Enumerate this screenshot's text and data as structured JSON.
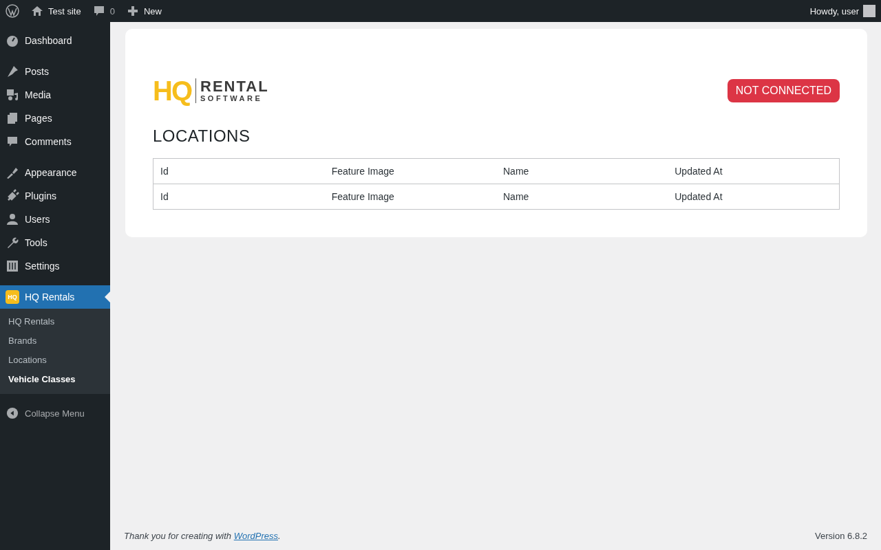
{
  "admin_bar": {
    "site_name": "Test site",
    "comments_count": "0",
    "new_label": "New",
    "greeting": "Howdy, user"
  },
  "sidebar": {
    "groups": [
      [
        {
          "label": "Dashboard",
          "kind": "dashboard",
          "selected": false
        }
      ],
      [
        {
          "label": "Posts",
          "kind": "pin",
          "selected": false
        },
        {
          "label": "Media",
          "kind": "media",
          "selected": false
        },
        {
          "label": "Pages",
          "kind": "pages",
          "selected": false
        },
        {
          "label": "Comments",
          "kind": "comment",
          "selected": false
        }
      ],
      [
        {
          "label": "Appearance",
          "kind": "brush",
          "selected": false
        },
        {
          "label": "Plugins",
          "kind": "plug",
          "selected": false
        },
        {
          "label": "Users",
          "kind": "user",
          "selected": false
        },
        {
          "label": "Tools",
          "kind": "wrench",
          "selected": false
        },
        {
          "label": "Settings",
          "kind": "sliders",
          "selected": false
        }
      ],
      [
        {
          "label": "HQ Rentals",
          "kind": "hq",
          "icon_text": "HQ",
          "selected": true,
          "submenu": [
            {
              "label": "HQ Rentals",
              "selected": false
            },
            {
              "label": "Brands",
              "selected": false
            },
            {
              "label": "Locations",
              "selected": false
            },
            {
              "label": "Vehicle Classes",
              "selected": true
            }
          ]
        }
      ]
    ],
    "collapse_label": "Collapse Menu"
  },
  "logo": {
    "mark": "HQ",
    "word": "RENTAL",
    "sub": "SOFTWARE"
  },
  "status_badge": {
    "label": "NOT CONNECTED",
    "connected": false
  },
  "heading": "LOCATIONS",
  "table": {
    "columns": [
      "Id",
      "Feature Image",
      "Name",
      "Updated At"
    ],
    "footer": [
      "Id",
      "Feature Image",
      "Name",
      "Updated At"
    ]
  },
  "footer": {
    "thanks_prefix": "Thank you for creating with ",
    "link": "WordPress",
    "thanks_suffix": ".",
    "version": "Version 6.8.2"
  }
}
